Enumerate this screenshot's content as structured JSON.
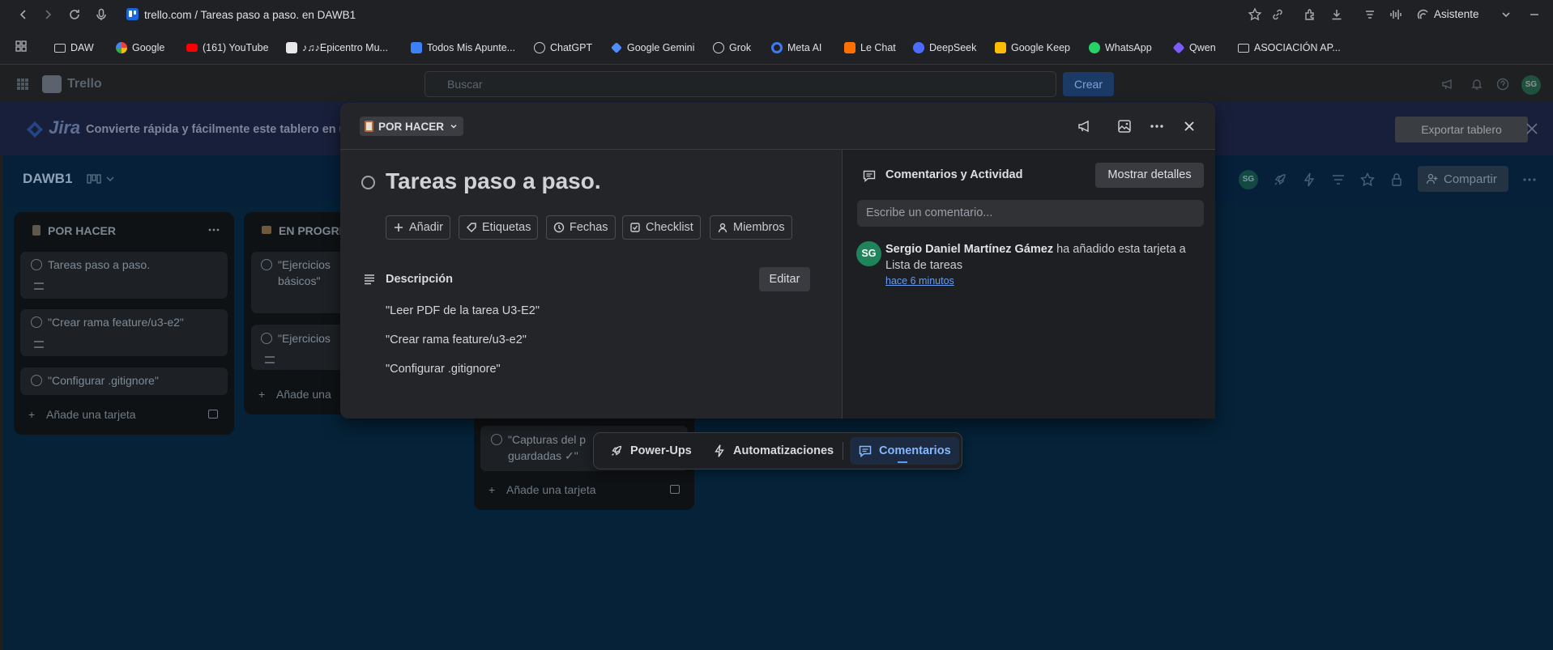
{
  "browser": {
    "url": "trello.com / Tareas paso a paso. en DAWB1",
    "assistant_label": "Asistente",
    "bookmarks": [
      {
        "label": "DAW",
        "color": "#c8c8c8"
      },
      {
        "label": "Google",
        "color": "#ffffff"
      },
      {
        "label": "(161) YouTube",
        "color": "#ff0000"
      },
      {
        "label": "♪♫♪Epicentro Mu...",
        "color": "#e8e8e8"
      },
      {
        "label": "Todos Mis Apunte...",
        "color": "#3b82f6"
      },
      {
        "label": "ChatGPT",
        "color": "#cfcfcf"
      },
      {
        "label": "Google Gemini",
        "color": "#4f8df7"
      },
      {
        "label": "Grok",
        "color": "#d0d0d0"
      },
      {
        "label": "Meta AI",
        "color": "#3d7bf5"
      },
      {
        "label": "Le Chat",
        "color": "#ff7000"
      },
      {
        "label": "DeepSeek",
        "color": "#4d6bfe"
      },
      {
        "label": "Google Keep",
        "color": "#fbbc04"
      },
      {
        "label": "WhatsApp",
        "color": "#25d366"
      },
      {
        "label": "Qwen",
        "color": "#7c5cff"
      },
      {
        "label": "ASOCIACIÓN AP...",
        "color": "#c8c8c8"
      }
    ]
  },
  "app": {
    "name": "Trello",
    "search_placeholder": "Buscar",
    "create_label": "Crear",
    "user_initials": "SG"
  },
  "banner": {
    "brand": "Jira",
    "text": "Convierte rápida y fácilmente este tablero en u",
    "export_label": "Exportar tablero"
  },
  "board": {
    "title": "DAWB1",
    "share_label": "Compartir",
    "lists": [
      {
        "title": "POR HACER",
        "cards": [
          "Tareas paso a paso.",
          "\"Crear rama feature/u3-e2\"",
          "\"Configurar .gitignore\""
        ],
        "add_label": "Añade una tarjeta"
      },
      {
        "title": "EN PROGRE",
        "cards": [
          "\"Ejercicios",
          "básicos\"",
          "\"Ejercicios"
        ],
        "add_label": "Añade una"
      },
      {
        "title": "",
        "cards": [
          "\"Capturas del p",
          "guardadas ✓\""
        ],
        "add_label": "Añade una tarjeta"
      }
    ]
  },
  "modal": {
    "list_name": "POR HACER",
    "card_title": "Tareas paso a paso.",
    "actions": [
      "Añadir",
      "Etiquetas",
      "Fechas",
      "Checklist",
      "Miembros"
    ],
    "description_title": "Descripción",
    "edit_label": "Editar",
    "description_lines": [
      "\"Leer PDF de la tarea U3-E2\"",
      "\"Crear rama feature/u3-e2\"",
      "\"Configurar .gitignore\""
    ],
    "comments_title": "Comentarios y Actividad",
    "show_details_label": "Mostrar detalles",
    "comment_placeholder": "Escribe un comentario...",
    "activity": {
      "avatar": "SG",
      "user": "Sergio Daniel Martínez Gámez",
      "text": " ha añadido esta tarjeta a Lista de tareas",
      "time": "hace 6 minutos"
    }
  },
  "float_bar": {
    "powerups_label": "Power-Ups",
    "automation_label": "Automatizaciones",
    "comments_label": "Comentarios"
  }
}
